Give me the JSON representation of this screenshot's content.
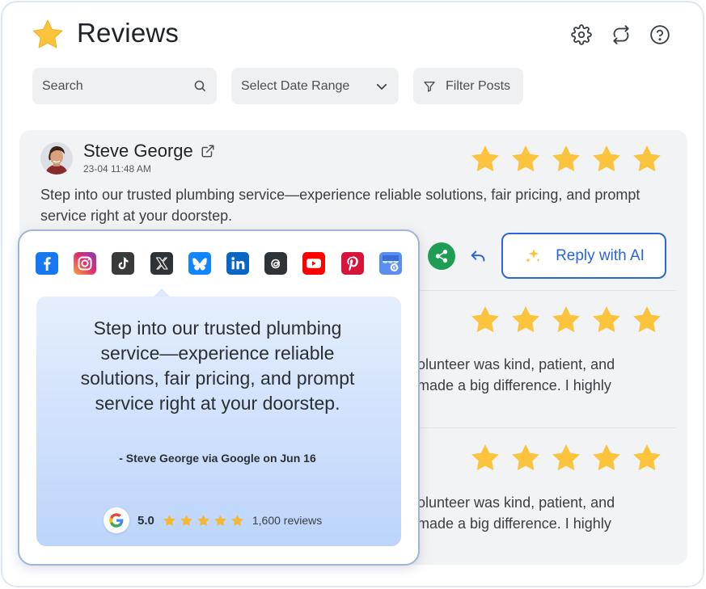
{
  "header": {
    "title": "Reviews",
    "icons": [
      "star-icon",
      "gear-icon",
      "refresh-icon",
      "help-icon"
    ]
  },
  "toolbar": {
    "search_placeholder": "Search",
    "date_range_label": "Select Date Range",
    "filter_label": "Filter Posts"
  },
  "review": {
    "author": "Steve George",
    "timestamp": "23-04 11:48 AM",
    "rating": 5,
    "text": "Step into our trusted plumbing service—experience reliable solutions, fair pricing, and prompt service right at your doorstep.",
    "reply_ai_label": "Reply with AI"
  },
  "other_reviews": [
    {
      "rating": 5,
      "line1": "olunteer was kind, patient, and",
      "line2": "made a big difference. I highly"
    },
    {
      "rating": 5,
      "line1": "olunteer was kind, patient, and",
      "line2": "made a big difference. I highly"
    }
  ],
  "share_popup": {
    "platforms": [
      "facebook-icon",
      "instagram-icon",
      "tiktok-icon",
      "x-icon",
      "bluesky-icon",
      "linkedin-icon",
      "threads-icon",
      "youtube-icon",
      "pinterest-icon",
      "google-business-icon"
    ],
    "selected_platform": "x-icon",
    "quote": "Step into our trusted plumbing service—experience reliable solutions, fair pricing, and prompt service right at your doorstep.",
    "attribution": "- Steve George via Google on Jun 16",
    "rating_value": "5.0",
    "review_count": "1,600 reviews"
  },
  "colors": {
    "star": "#fbc43c",
    "accent": "#2a66d9",
    "share_green": "#1f9d55",
    "card_bg": "#f2f3f4"
  }
}
